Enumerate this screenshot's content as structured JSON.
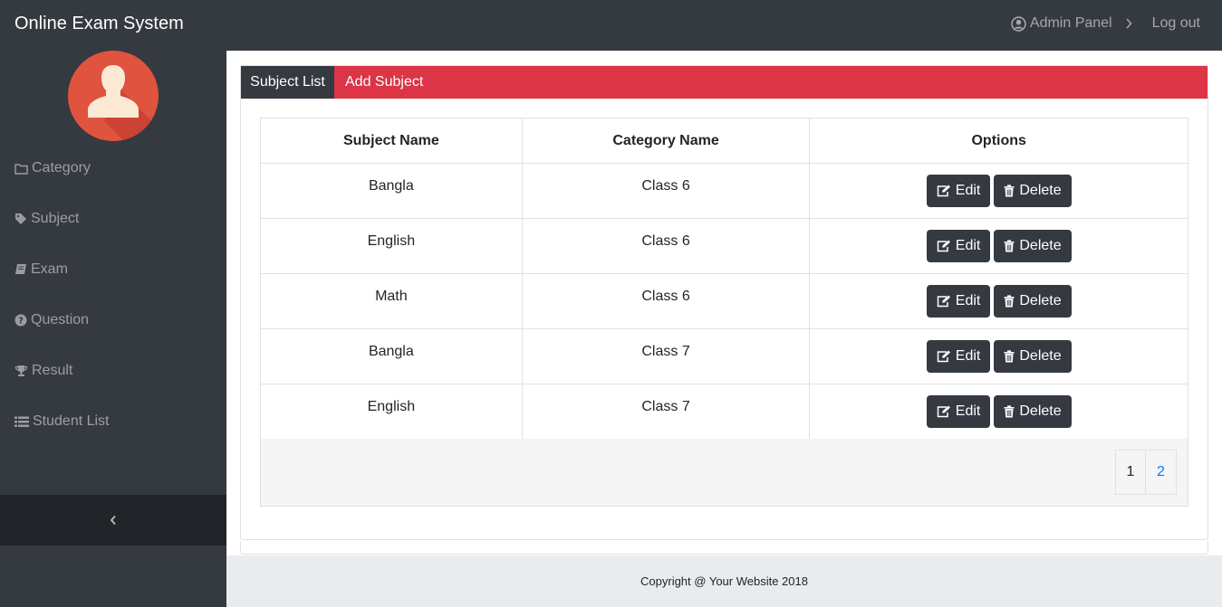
{
  "navbar": {
    "brand": "Online Exam System",
    "admin_label": "Admin Panel",
    "logout_label": "Log out"
  },
  "sidebar": {
    "items": [
      {
        "label": "Category",
        "icon": "folder-icon"
      },
      {
        "label": "Subject",
        "icon": "tag-icon"
      },
      {
        "label": "Exam",
        "icon": "book-icon"
      },
      {
        "label": "Question",
        "icon": "question-circle-icon"
      },
      {
        "label": "Result",
        "icon": "trophy-icon"
      },
      {
        "label": "Student List",
        "icon": "list-icon"
      }
    ]
  },
  "tabs": {
    "active": "Subject List",
    "add": "Add Subject"
  },
  "table": {
    "headers": [
      "Subject Name",
      "Category Name",
      "Options"
    ],
    "rows": [
      {
        "subject": "Bangla",
        "category": "Class 6"
      },
      {
        "subject": "English",
        "category": "Class 6"
      },
      {
        "subject": "Math",
        "category": "Class 6"
      },
      {
        "subject": "Bangla",
        "category": "Class 7"
      },
      {
        "subject": "English",
        "category": "Class 7"
      }
    ],
    "edit_label": "Edit",
    "delete_label": "Delete"
  },
  "pagination": [
    "1",
    "2"
  ],
  "footer": {
    "text": "Copyright @ Your Website 2018"
  },
  "colors": {
    "dark": "#343a40",
    "accent": "#dc3545",
    "link": "#007bff"
  }
}
